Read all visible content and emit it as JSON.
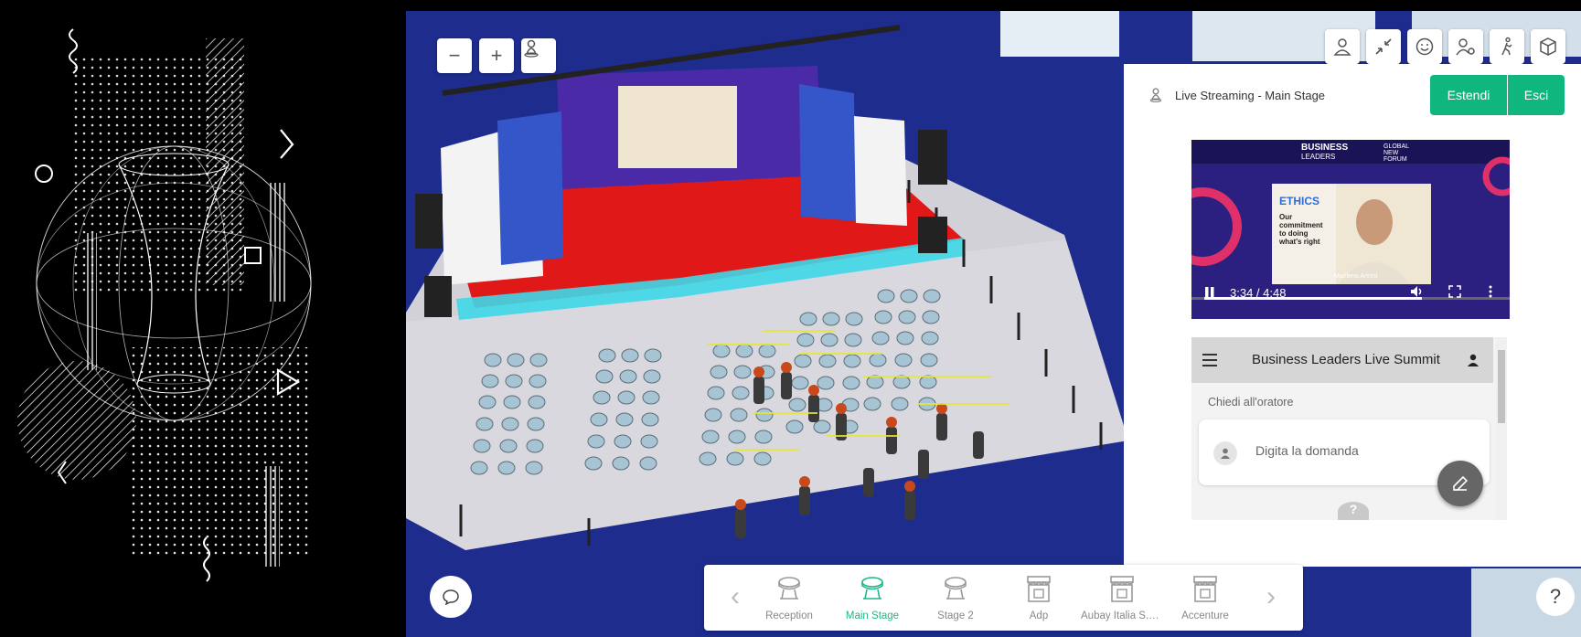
{
  "controls": {
    "zoom_out": "−",
    "zoom_in": "+"
  },
  "toolbar": {
    "icons": [
      "user-icon",
      "collapse-icon",
      "emoji-icon",
      "user-settings-icon",
      "walk-icon",
      "cube-icon"
    ]
  },
  "panel": {
    "title": "Live Streaming - Main Stage",
    "expand_label": "Estendi",
    "exit_label": "Esci",
    "accent": "#0fb77e"
  },
  "video": {
    "time": "3:34 / 4:48",
    "progress": 0.744,
    "brand_line1": "BUSINESS",
    "brand_line2": "LEADERS",
    "forum": "GLOBAL NEW FORUM",
    "slide_title": "ETHICS",
    "slide_text": "Our commitment to doing what's right",
    "speaker": "Marilena Arinisi"
  },
  "chat": {
    "title": "Business Leaders Live Summit",
    "ask_label": "Chiedi all'oratore",
    "ask_placeholder": "Digita la domanda"
  },
  "nav": {
    "items": [
      {
        "label": "Reception",
        "icon": "stage-icon",
        "active": false
      },
      {
        "label": "Main Stage",
        "icon": "stage-icon",
        "active": true
      },
      {
        "label": "Stage 2",
        "icon": "stage-icon",
        "active": false
      },
      {
        "label": "Adp",
        "icon": "booth-icon",
        "active": false
      },
      {
        "label": "Aubay Italia S.p...",
        "icon": "booth-icon",
        "active": false
      },
      {
        "label": "Accenture",
        "icon": "booth-icon",
        "active": false
      }
    ],
    "active_color": "#1fb68a"
  },
  "help": "?"
}
